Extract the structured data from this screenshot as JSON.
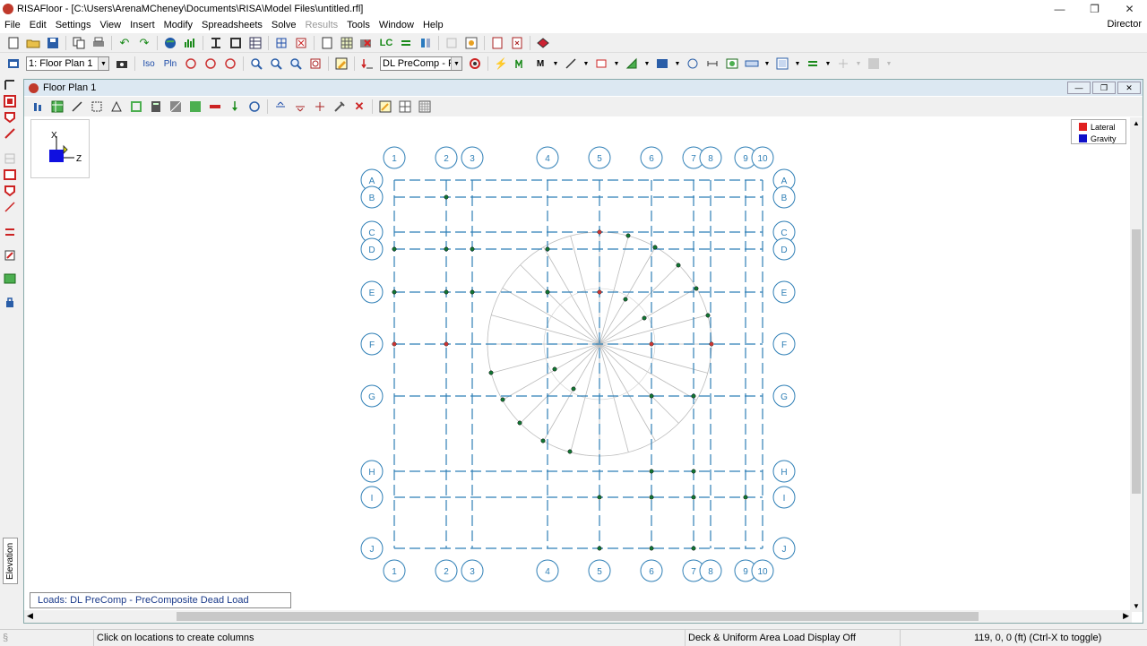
{
  "window": {
    "title": "RISAFloor - [C:\\Users\\ArenaMCheney\\Documents\\RISA\\Model Files\\untitled.rfl]",
    "user": "Director"
  },
  "menu": [
    {
      "label": "File",
      "disabled": false
    },
    {
      "label": "Edit",
      "disabled": false
    },
    {
      "label": "Settings",
      "disabled": false
    },
    {
      "label": "View",
      "disabled": false
    },
    {
      "label": "Insert",
      "disabled": false
    },
    {
      "label": "Modify",
      "disabled": false
    },
    {
      "label": "Spreadsheets",
      "disabled": false
    },
    {
      "label": "Solve",
      "disabled": false
    },
    {
      "label": "Results",
      "disabled": true
    },
    {
      "label": "Tools",
      "disabled": false
    },
    {
      "label": "Window",
      "disabled": false
    },
    {
      "label": "Help",
      "disabled": false
    }
  ],
  "toolbar": {
    "floor_select": "1: Floor Plan 1",
    "iso_label": "Iso",
    "pln_label": "Pln",
    "load_select": "DL PreComp - Pr",
    "lc_label": "LC"
  },
  "subwindow": {
    "title": "Floor Plan 1"
  },
  "axes": {
    "x": "X",
    "z": "Z"
  },
  "legend": [
    {
      "label": "Lateral",
      "color": "#e02020"
    },
    {
      "label": "Gravity",
      "color": "#1010c8"
    }
  ],
  "elevation_tab": "Elevation",
  "loads_label": "Loads: DL PreComp - PreComposite Dead Load",
  "status": {
    "hint": "Click on locations to create columns",
    "display": "Deck & Uniform Area Load Display Off",
    "coords": "119, 0, 0 (ft)  (Ctrl-X to toggle)"
  },
  "grid": {
    "columns": [
      "1",
      "2",
      "3",
      "4",
      "5",
      "6",
      "7",
      "8",
      "9",
      "10"
    ],
    "rows": [
      "A",
      "B",
      "C",
      "D",
      "E",
      "F",
      "G",
      "H",
      "I",
      "J"
    ],
    "line_color": "#2f7fb6"
  }
}
